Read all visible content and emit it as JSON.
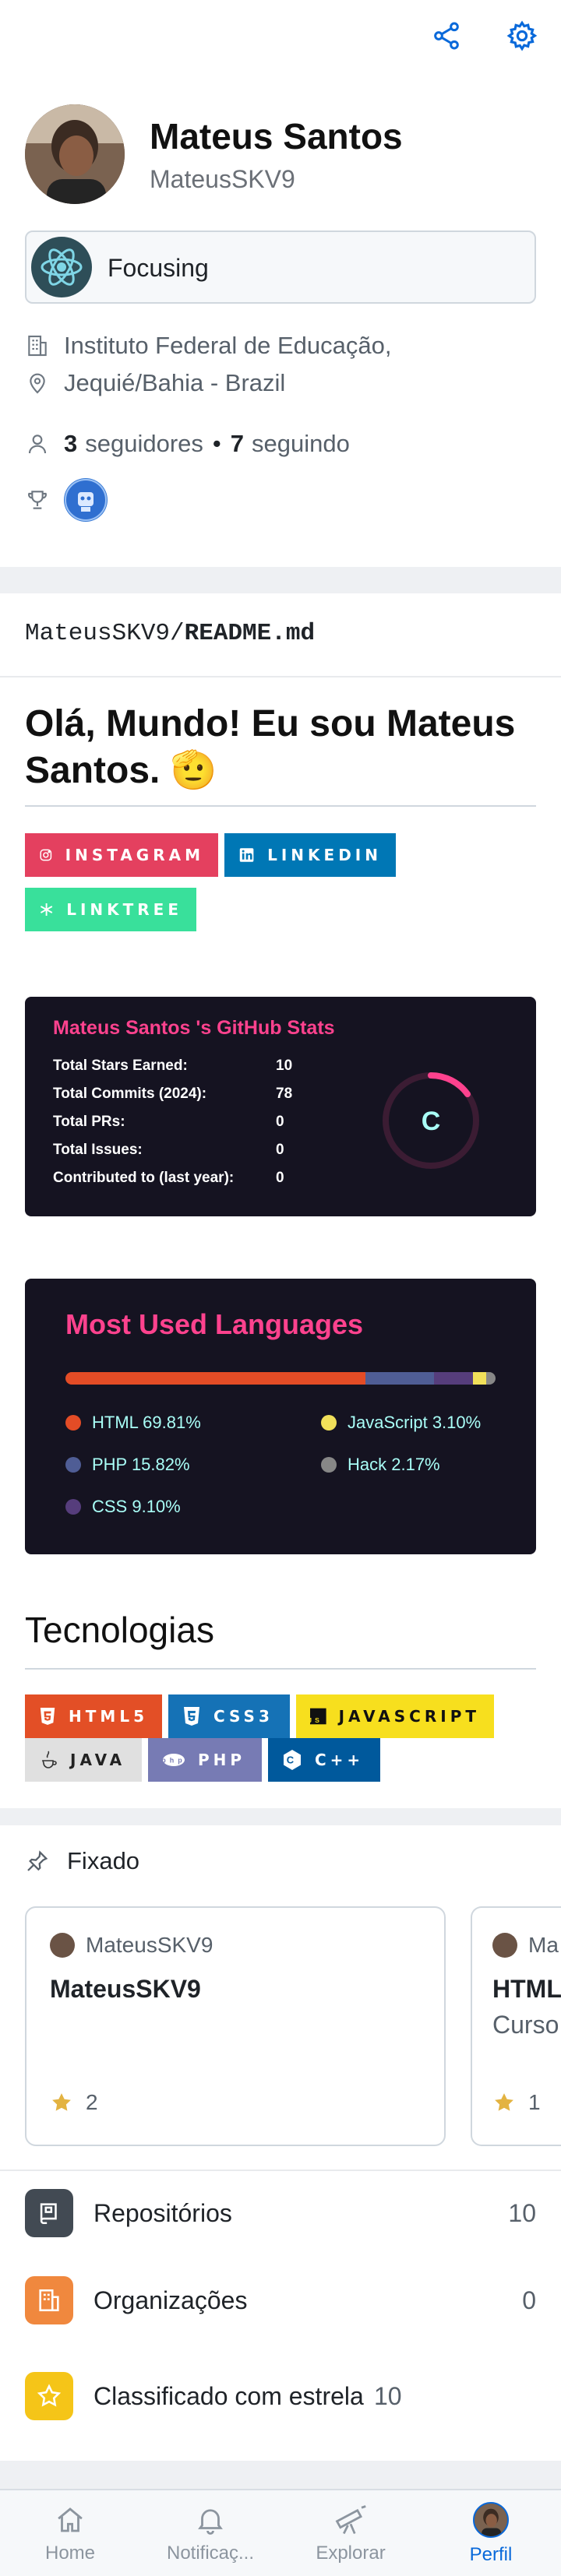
{
  "profile": {
    "name": "Mateus Santos",
    "login": "MateusSKV9",
    "status": "Focusing",
    "company": "Instituto Federal de Educação,",
    "location": "Jequié/Bahia - Brazil",
    "followers_count": "3",
    "followers_label": "seguidores",
    "separator": "•",
    "following_count": "7",
    "following_label": "seguindo"
  },
  "readme": {
    "path_owner": "MateusSKV9/",
    "path_file": "README.md",
    "heading": "Olá, Mundo! Eu sou Mateus Santos. 🫡",
    "social_badges": [
      "INSTAGRAM",
      "LINKEDIN",
      "LINKTREE"
    ],
    "stats": {
      "title": "Mateus Santos 's GitHub Stats",
      "rows": [
        {
          "label": "Total Stars Earned:",
          "value": "10"
        },
        {
          "label": "Total Commits (2024):",
          "value": "78"
        },
        {
          "label": "Total PRs:",
          "value": "0"
        },
        {
          "label": "Total Issues:",
          "value": "0"
        },
        {
          "label": "Contributed to (last year):",
          "value": "0"
        }
      ],
      "rank": "C"
    },
    "languages": {
      "title": "Most Used Languages",
      "items": [
        {
          "label": "HTML 69.81%",
          "percent": 69.81,
          "color": "#e34c26"
        },
        {
          "label": "PHP 15.82%",
          "percent": 15.82,
          "color": "#4F5D95"
        },
        {
          "label": "CSS 9.10%",
          "percent": 9.1,
          "color": "#563d7c"
        },
        {
          "label": "JavaScript 3.10%",
          "percent": 3.1,
          "color": "#f1e05a"
        },
        {
          "label": "Hack 2.17%",
          "percent": 2.17,
          "color": "#878787"
        }
      ]
    },
    "tech_heading": "Tecnologias",
    "tech_badges": [
      "HTML5",
      "CSS3",
      "JAVASCRIPT",
      "JAVA",
      "PHP",
      "C++"
    ]
  },
  "pinned": {
    "heading": "Fixado",
    "cards": [
      {
        "owner": "MateusSKV9",
        "repo": "MateusSKV9",
        "description": "",
        "stars": "2"
      },
      {
        "owner": "Ma",
        "repo": "HTML",
        "description": "Curso",
        "stars": "1"
      }
    ]
  },
  "menu": [
    {
      "label": "Repositórios",
      "count": "10",
      "color": "#424a53"
    },
    {
      "label": "Organizações",
      "count": "0",
      "color": "#f0883e"
    },
    {
      "label": "Classificado com estrela",
      "count": "10",
      "color": "#f5c518"
    }
  ],
  "tabs": [
    {
      "label": "Home",
      "icon": "home-icon"
    },
    {
      "label": "Notificaç...",
      "icon": "bell-icon"
    },
    {
      "label": "Explorar",
      "icon": "telescope-icon"
    },
    {
      "label": "Perfil",
      "icon": "avatar"
    }
  ],
  "colors": {
    "accent": "#0969da",
    "instagram": "#E4405F",
    "linkedin": "#0077B5",
    "linktree": "#39E09B",
    "html5": "#E34F26",
    "css3": "#1572B6",
    "javascript": "#F7DF1E",
    "java": "#E0E0E0",
    "php": "#777BB4",
    "cpp": "#00599C",
    "stats_bg": "#151321",
    "stats_title": "#fe428e"
  }
}
